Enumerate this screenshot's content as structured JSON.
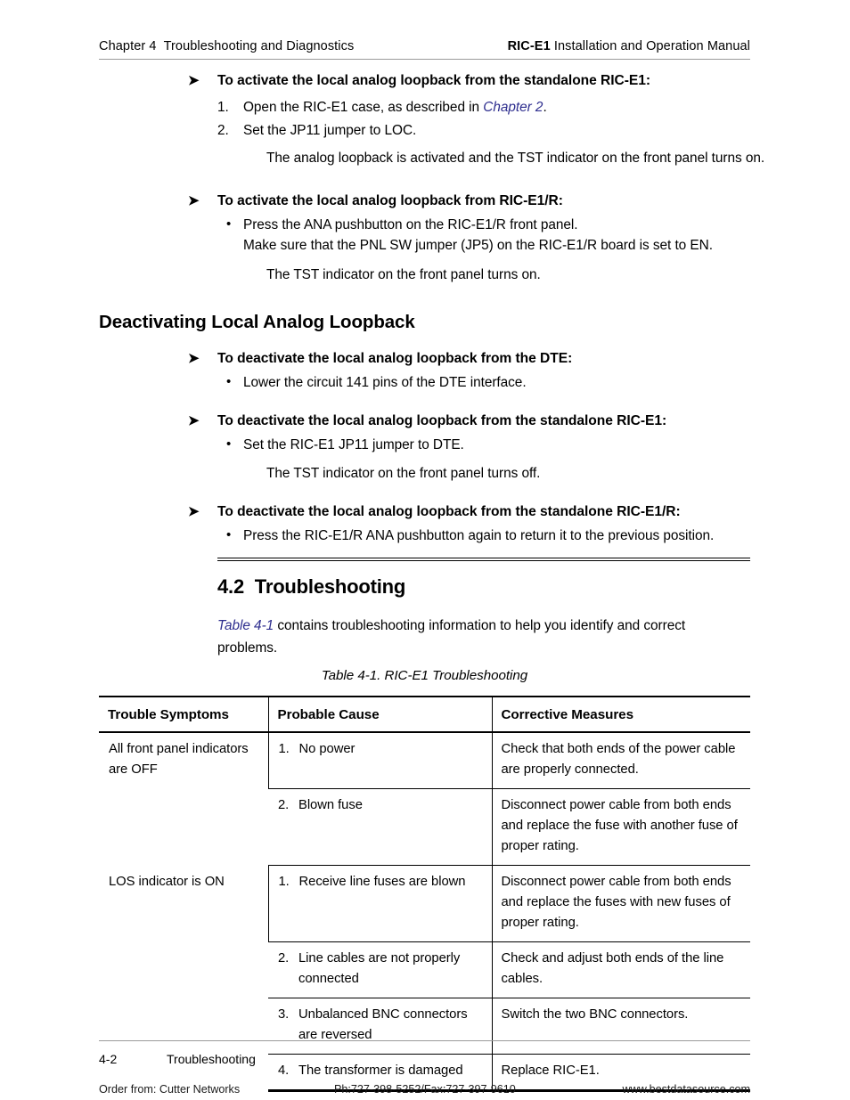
{
  "header": {
    "left": "Chapter 4  Troubleshooting and Diagnostics",
    "right_bold": "RIC-E1",
    "right_rest": " Installation and Operation Manual"
  },
  "arrow_glyph": "➤",
  "bullet_glyph": "•",
  "sections": [
    {
      "heading": "To activate the local analog loopback from the standalone RIC-E1:",
      "steps": [
        {
          "num": "1.",
          "text_before": "Open the RIC-E1 case, as described in ",
          "xref": "Chapter 2",
          "text_after": "."
        },
        {
          "num": "2.",
          "text_before": "Set the JP11 jumper to LOC.",
          "xref": "",
          "text_after": ""
        }
      ],
      "note": "The analog loopback is activated and the TST indicator on the front panel turns on."
    },
    {
      "heading": "To activate the local analog loopback from RIC-E1/R:",
      "bullets": [
        "Press the ANA pushbutton on the RIC-E1/R front panel.",
        "Make sure that the PNL SW jumper (JP5) on the RIC-E1/R board is set to EN."
      ],
      "note": "The TST indicator on the front panel turns on."
    }
  ],
  "subsection_title": "Deactivating Local Analog Loopback",
  "deactivate": [
    {
      "heading": "To deactivate the local analog loopback from the DTE:",
      "bullet": "Lower the circuit 141 pins of the DTE interface.",
      "note": ""
    },
    {
      "heading": "To deactivate the local analog loopback from the standalone RIC-E1:",
      "bullet": "Set the RIC-E1 JP11 jumper to DTE.",
      "note": "The TST indicator on the front panel turns off."
    },
    {
      "heading": "To deactivate the local analog loopback from the standalone RIC-E1/R:",
      "bullet": "Press the RIC-E1/R ANA pushbutton again to return it to the previous position.",
      "note": ""
    }
  ],
  "section42": {
    "number": "4.2",
    "title": "Troubleshooting",
    "heading_full": "4.2  Troubleshooting",
    "intro_xref": "Table 4-1",
    "intro_rest": " contains troubleshooting information to help you identify and correct problems."
  },
  "table": {
    "caption": "Table 4-1.  RIC-E1 Troubleshooting",
    "columns": [
      "Trouble Symptoms",
      "Probable Cause",
      "Corrective Measures"
    ],
    "groups": [
      {
        "symptom": "All front panel indicators are OFF",
        "rows": [
          {
            "num": "1.",
            "cause": "No power",
            "measure": "Check that both ends of the power cable are properly connected."
          },
          {
            "num": "2.",
            "cause": "Blown fuse",
            "measure": "Disconnect power cable from both ends and replace the fuse with another fuse of proper rating."
          }
        ]
      },
      {
        "symptom": "LOS indicator is ON",
        "rows": [
          {
            "num": "1.",
            "cause": "Receive line fuses are blown",
            "measure": "Disconnect power cable from both ends and replace the fuses with new fuses of proper rating."
          },
          {
            "num": "2.",
            "cause": "Line cables are not properly connected",
            "measure": "Check and adjust both ends of the line cables."
          },
          {
            "num": "3.",
            "cause": "Unbalanced BNC connectors are reversed",
            "measure": "Switch the two BNC connectors."
          },
          {
            "num": "4.",
            "cause": "The transformer is damaged",
            "measure": "Replace RIC-E1."
          }
        ]
      }
    ]
  },
  "footer": {
    "page_number": "4-2",
    "section_name": "Troubleshooting"
  },
  "stamp": {
    "left": "Order from: Cutter Networks",
    "middle": "Ph:727-398-5252/Fax:727-397-9610",
    "right": "www.bestdatasource.com"
  },
  "colors": {
    "xref": "#2f2f8f",
    "rule": "#9a9a9a",
    "text": "#000000"
  }
}
